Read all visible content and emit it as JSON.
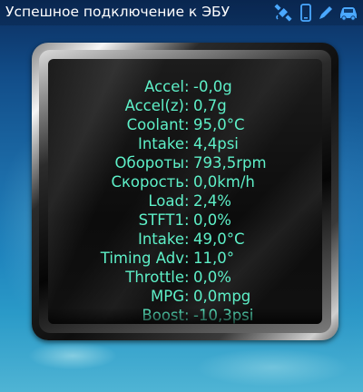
{
  "status_bar": {
    "title": "Успешное подключение к ЭБУ",
    "icons": [
      "satellite-icon",
      "phone-icon",
      "pencil-icon",
      "car-icon"
    ],
    "icon_color": "#4aa8ff"
  },
  "gauge": {
    "text_color": "#5ef0c8",
    "rows": [
      {
        "label": "Accel",
        "value": "-0,0g"
      },
      {
        "label": "Accel(z)",
        "value": "0,7g"
      },
      {
        "label": "Coolant",
        "value": "95,0°C"
      },
      {
        "label": "Intake",
        "value": "4,4psi"
      },
      {
        "label": "Обороты",
        "value": "793,5rpm"
      },
      {
        "label": "Скорость",
        "value": "0,0km/h"
      },
      {
        "label": "Load",
        "value": "2,4%"
      },
      {
        "label": "STFT1",
        "value": "0,0%"
      },
      {
        "label": "Intake",
        "value": "49,0°C"
      },
      {
        "label": "Timing Adv",
        "value": "11,0°"
      },
      {
        "label": "Throttle",
        "value": "0,0%"
      },
      {
        "label": "MPG",
        "value": "0,0mpg"
      },
      {
        "label": "Boost",
        "value": "-10,3psi"
      }
    ]
  }
}
